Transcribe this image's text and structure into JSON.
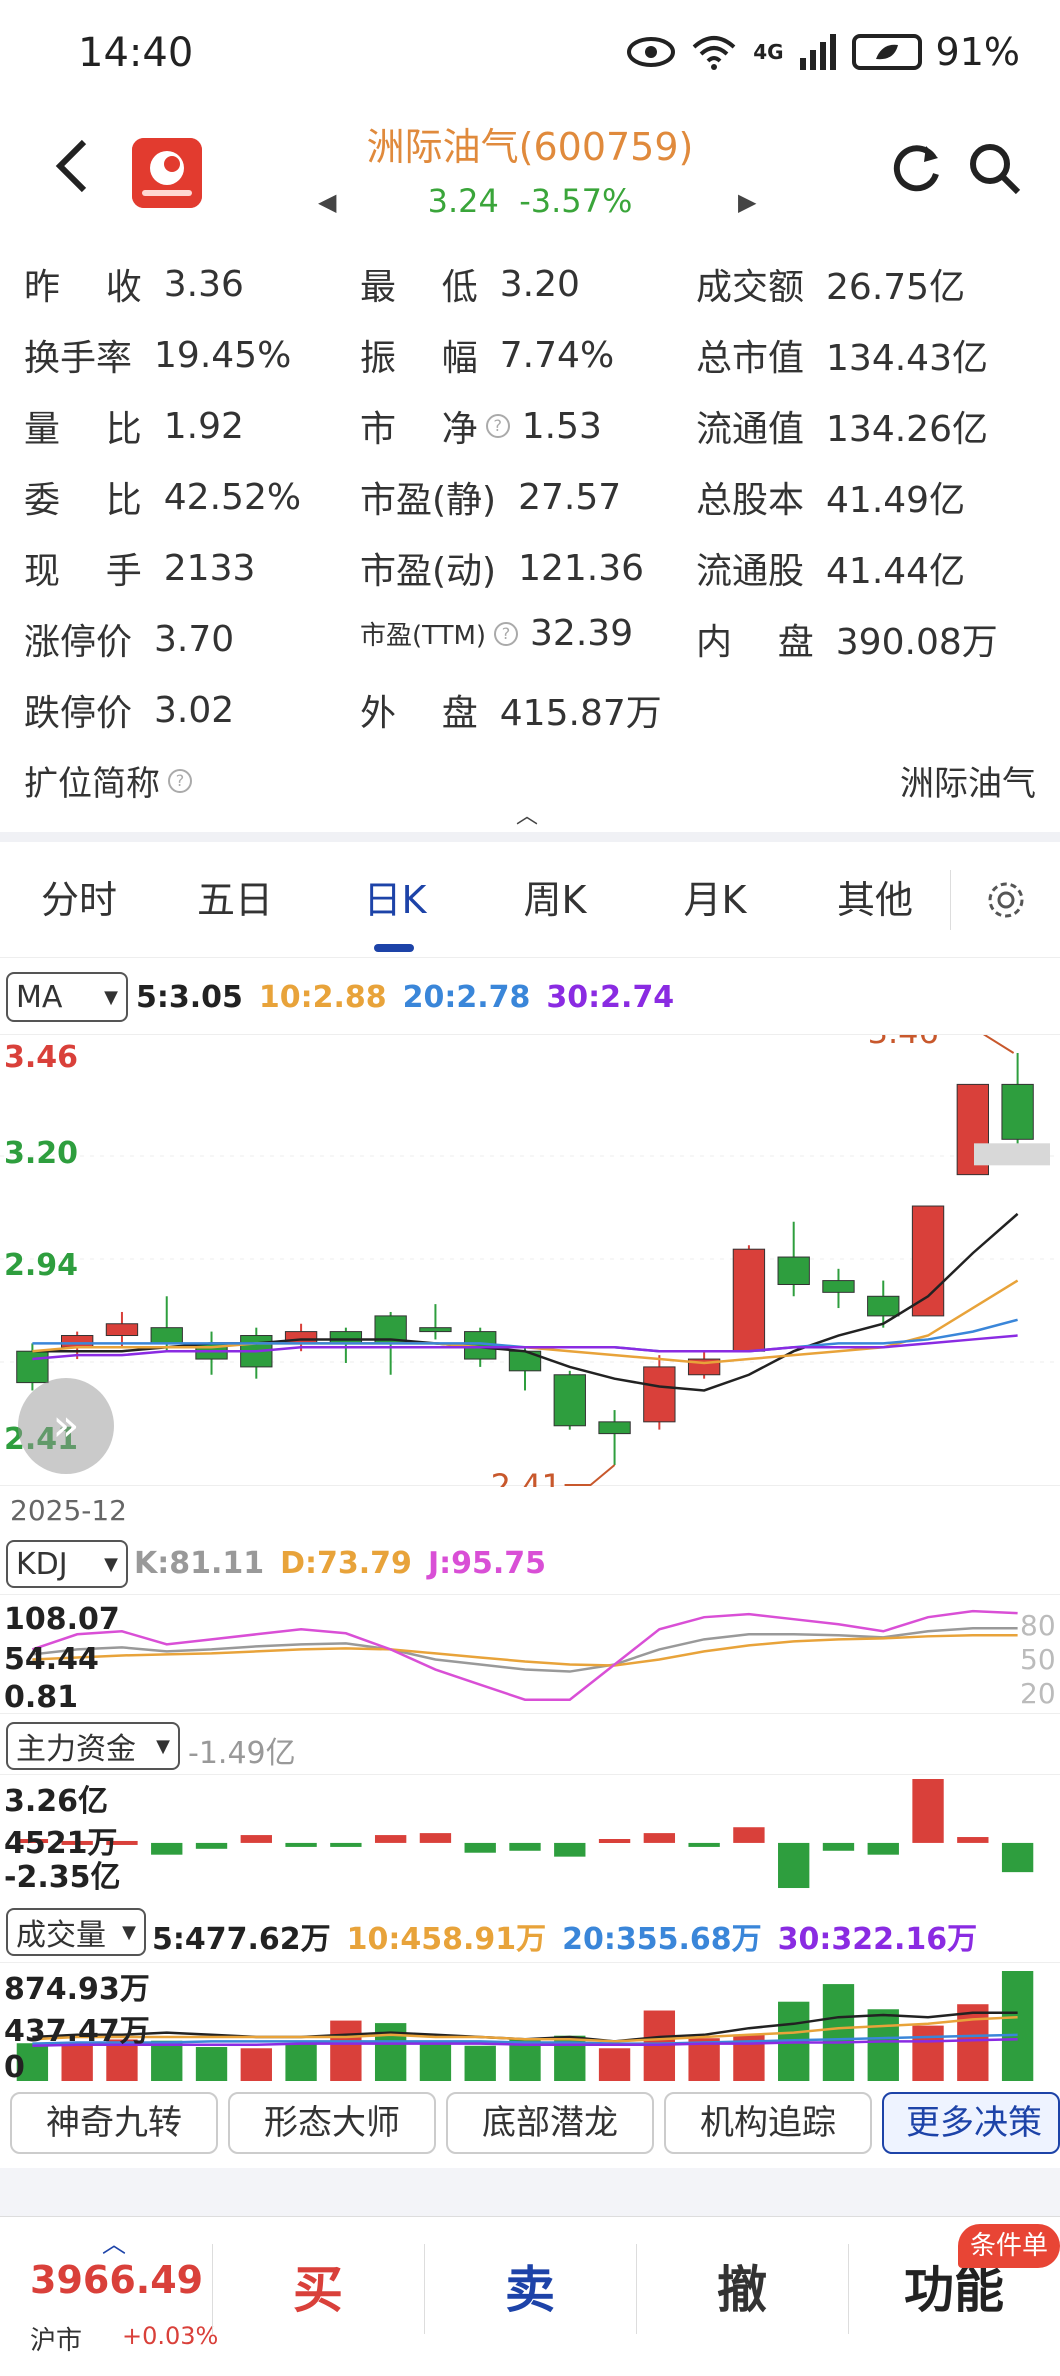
{
  "status": {
    "time": "14:40",
    "battery": "91%",
    "network": "4G"
  },
  "header": {
    "name": "洲际油气(600759)",
    "price": "3.24",
    "change": "-3.57%"
  },
  "info": {
    "rows": [
      [
        {
          "l": "昨    收",
          "v": "3.36",
          "c": ""
        },
        {
          "l": "最    低",
          "v": "3.20",
          "c": ""
        },
        {
          "l": "成交额",
          "v": "26.75亿",
          "c": ""
        }
      ],
      [
        {
          "l": "换手率",
          "v": "19.45%",
          "c": ""
        },
        {
          "l": "振    幅",
          "v": "7.74%",
          "c": ""
        },
        {
          "l": "总市值",
          "v": "134.43亿",
          "c": ""
        }
      ],
      [
        {
          "l": "量    比",
          "v": "1.92",
          "c": ""
        },
        {
          "l": "市    净",
          "v": "1.53",
          "c": "",
          "q": true
        },
        {
          "l": "流通值",
          "v": "134.26亿",
          "c": ""
        }
      ],
      [
        {
          "l": "委    比",
          "v": "42.52%",
          "c": ""
        },
        {
          "l": "市盈(静)",
          "v": "27.57",
          "c": ""
        },
        {
          "l": "总股本",
          "v": "41.49亿",
          "c": ""
        }
      ],
      [
        {
          "l": "现    手",
          "v": "2133",
          "c": ""
        },
        {
          "l": "市盈(动)",
          "v": "121.36",
          "c": ""
        },
        {
          "l": "流通股",
          "v": "41.44亿",
          "c": ""
        }
      ],
      [
        {
          "l": "涨停价",
          "v": "3.70",
          "c": ""
        },
        {
          "l": "市盈(TTM)",
          "v": "32.39",
          "c": "",
          "q": true,
          "small": true
        },
        {
          "l": "内    盘",
          "v": "390.08万",
          "c": ""
        }
      ],
      [
        {
          "l": "跌停价",
          "v": "3.02",
          "c": ""
        },
        {
          "l": "外    盘",
          "v": "415.87万",
          "c": ""
        }
      ]
    ],
    "expand_label": "扩位简称",
    "expand_value": "洲际油气"
  },
  "tabs": [
    "分时",
    "五日",
    "日K",
    "周K",
    "月K",
    "其他"
  ],
  "active_tab": 2,
  "ma": {
    "selector": "MA",
    "legend": [
      {
        "t": "5:3.05",
        "c": "#222222"
      },
      {
        "t": "10:2.88",
        "c": "#e8a33a"
      },
      {
        "t": "20:2.78",
        "c": "#3a86d9"
      },
      {
        "t": "30:2.74",
        "c": "#8a2be2"
      }
    ]
  },
  "kdj": {
    "selector": "KDJ",
    "legend": [
      {
        "t": "K:81.11",
        "c": "#999999"
      },
      {
        "t": "D:73.79",
        "c": "#e8a33a"
      },
      {
        "t": "J:95.75",
        "c": "#d94fd6"
      }
    ],
    "y_labels": [
      "108.07",
      "54.44",
      "0.81"
    ],
    "right_labels": [
      "80",
      "50",
      "20"
    ]
  },
  "flow": {
    "selector": "主力资金",
    "value": "-1.49亿",
    "y_labels": [
      "3.26亿",
      "4521万",
      "-2.35亿"
    ]
  },
  "volume": {
    "selector": "成交量",
    "legend": [
      {
        "t": "5:477.62万",
        "c": "#222222"
      },
      {
        "t": "10:458.91万",
        "c": "#e8a33a"
      },
      {
        "t": "20:355.68万",
        "c": "#3a86d9"
      },
      {
        "t": "30:322.16万",
        "c": "#8a2be2"
      }
    ],
    "y_labels": [
      "874.93万",
      "437.47万",
      "0"
    ]
  },
  "chart_data": {
    "type": "candlestick",
    "y_labels": [
      "3.46",
      "3.20",
      "2.94",
      "2.41"
    ],
    "annotations": [
      "3.46",
      "2.41"
    ],
    "date_label": "2025-12",
    "candles": [
      {
        "o": 2.7,
        "h": 2.72,
        "l": 2.6,
        "c": 2.62
      },
      {
        "o": 2.71,
        "h": 2.75,
        "l": 2.68,
        "c": 2.74
      },
      {
        "o": 2.74,
        "h": 2.8,
        "l": 2.71,
        "c": 2.77
      },
      {
        "o": 2.76,
        "h": 2.84,
        "l": 2.7,
        "c": 2.72
      },
      {
        "o": 2.72,
        "h": 2.75,
        "l": 2.64,
        "c": 2.68
      },
      {
        "o": 2.74,
        "h": 2.76,
        "l": 2.63,
        "c": 2.66
      },
      {
        "o": 2.72,
        "h": 2.77,
        "l": 2.7,
        "c": 2.75
      },
      {
        "o": 2.75,
        "h": 2.76,
        "l": 2.67,
        "c": 2.72
      },
      {
        "o": 2.79,
        "h": 2.8,
        "l": 2.64,
        "c": 2.72
      },
      {
        "o": 2.76,
        "h": 2.82,
        "l": 2.73,
        "c": 2.75
      },
      {
        "o": 2.75,
        "h": 2.76,
        "l": 2.66,
        "c": 2.68
      },
      {
        "o": 2.7,
        "h": 2.71,
        "l": 2.6,
        "c": 2.65
      },
      {
        "o": 2.64,
        "h": 2.65,
        "l": 2.5,
        "c": 2.51
      },
      {
        "o": 2.52,
        "h": 2.55,
        "l": 2.41,
        "c": 2.49
      },
      {
        "o": 2.52,
        "h": 2.69,
        "l": 2.5,
        "c": 2.66
      },
      {
        "o": 2.64,
        "h": 2.7,
        "l": 2.63,
        "c": 2.68
      },
      {
        "o": 2.7,
        "h": 2.97,
        "l": 2.7,
        "c": 2.96
      },
      {
        "o": 2.94,
        "h": 3.03,
        "l": 2.84,
        "c": 2.87
      },
      {
        "o": 2.88,
        "h": 2.91,
        "l": 2.81,
        "c": 2.85
      },
      {
        "o": 2.84,
        "h": 2.88,
        "l": 2.76,
        "c": 2.79
      },
      {
        "o": 2.79,
        "h": 3.07,
        "l": 2.79,
        "c": 3.07
      },
      {
        "o": 3.15,
        "h": 3.38,
        "l": 3.15,
        "c": 3.38
      },
      {
        "o": 3.38,
        "h": 3.46,
        "l": 3.2,
        "c": 3.24
      }
    ],
    "ma5": [
      2.7,
      2.7,
      2.7,
      2.71,
      2.72,
      2.72,
      2.73,
      2.73,
      2.73,
      2.72,
      2.71,
      2.7,
      2.66,
      2.63,
      2.61,
      2.6,
      2.64,
      2.7,
      2.74,
      2.77,
      2.84,
      2.95,
      3.05
    ],
    "ma10": [
      2.7,
      2.71,
      2.71,
      2.71,
      2.71,
      2.72,
      2.72,
      2.72,
      2.72,
      2.72,
      2.71,
      2.71,
      2.7,
      2.69,
      2.68,
      2.67,
      2.68,
      2.69,
      2.7,
      2.71,
      2.74,
      2.81,
      2.88
    ],
    "ma20": [
      2.72,
      2.72,
      2.72,
      2.72,
      2.72,
      2.72,
      2.72,
      2.72,
      2.72,
      2.72,
      2.72,
      2.71,
      2.71,
      2.71,
      2.7,
      2.7,
      2.7,
      2.71,
      2.72,
      2.72,
      2.73,
      2.75,
      2.78
    ],
    "ma30": [
      2.68,
      2.69,
      2.69,
      2.7,
      2.7,
      2.7,
      2.71,
      2.71,
      2.71,
      2.71,
      2.71,
      2.71,
      2.71,
      2.71,
      2.7,
      2.7,
      2.7,
      2.71,
      2.71,
      2.71,
      2.72,
      2.73,
      2.74
    ],
    "kdj_k": [
      55,
      60,
      62,
      58,
      60,
      63,
      65,
      66,
      60,
      50,
      45,
      40,
      38,
      45,
      60,
      70,
      75,
      75,
      74,
      72,
      78,
      81,
      81
    ],
    "kdj_d": [
      50,
      52,
      54,
      55,
      56,
      58,
      60,
      61,
      60,
      56,
      52,
      48,
      45,
      44,
      50,
      58,
      64,
      68,
      70,
      71,
      73,
      74,
      74
    ],
    "kdj_j": [
      60,
      75,
      78,
      65,
      70,
      75,
      80,
      76,
      60,
      40,
      25,
      10,
      10,
      45,
      80,
      92,
      95,
      90,
      85,
      78,
      92,
      98,
      96
    ],
    "flow": [
      0.2,
      0.1,
      0.1,
      -0.6,
      -0.3,
      0.4,
      -0.1,
      -0.2,
      0.4,
      0.5,
      -0.5,
      -0.4,
      -0.7,
      0.2,
      0.5,
      -0.2,
      0.8,
      -2.3,
      -0.4,
      -0.6,
      3.26,
      0.3,
      -1.49
    ],
    "volumes": [
      300,
      300,
      330,
      320,
      270,
      260,
      300,
      480,
      460,
      320,
      280,
      340,
      360,
      260,
      560,
      340,
      370,
      630,
      770,
      570,
      440,
      610,
      874
    ],
    "vol_up": [
      false,
      true,
      true,
      false,
      false,
      true,
      false,
      true,
      false,
      false,
      false,
      false,
      false,
      true,
      true,
      true,
      true,
      false,
      false,
      false,
      true,
      true,
      false
    ]
  },
  "functions": [
    "神奇九转",
    "形态大师",
    "底部潜龙",
    "机构追踪",
    "更多决策"
  ],
  "bottom": {
    "index_value": "3966.49",
    "index_name": "沪市",
    "index_change": "+0.03%",
    "buttons": [
      {
        "t": "买",
        "c": "#d9403a"
      },
      {
        "t": "卖",
        "c": "#1d43a8"
      },
      {
        "t": "撤",
        "c": "#333333"
      },
      {
        "t": "功能",
        "c": "#222222"
      }
    ],
    "badge": "条件单"
  }
}
